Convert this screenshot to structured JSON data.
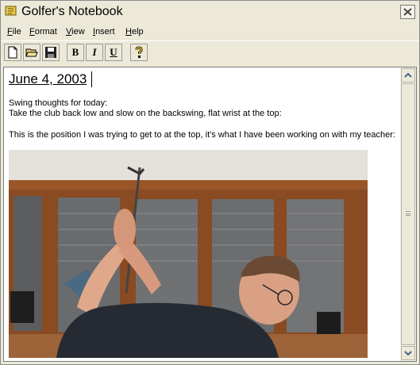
{
  "window": {
    "title": "Golfer's Notebook"
  },
  "menu": [
    {
      "label_acc": "F",
      "label_rest": "ile"
    },
    {
      "label_acc": "F",
      "label_rest": "ormat"
    },
    {
      "label_acc": "V",
      "label_rest": "iew"
    },
    {
      "label_acc": "I",
      "label_rest": "nsert"
    },
    {
      "label_acc": "H",
      "label_rest": "elp"
    }
  ],
  "toolbar": {
    "buttons": [
      "new-icon",
      "open-folder-icon",
      "save-disk-icon",
      "bold",
      "italic",
      "underline",
      "help-icon"
    ],
    "bold_label": "B",
    "italic_label": "I",
    "underline_label": "U"
  },
  "document": {
    "heading": "June 4, 2003",
    "lines": [
      "Swing thoughts for today:",
      "Take the club back low and slow on the backswing, flat wrist at the top:",
      "This is the position I was trying to get to at the top, it's what I have been working on with my teacher:"
    ]
  },
  "colors": {
    "chrome": "#ece9d8",
    "title_icon": "#e8c64a",
    "help_icon": "#f0c020"
  }
}
